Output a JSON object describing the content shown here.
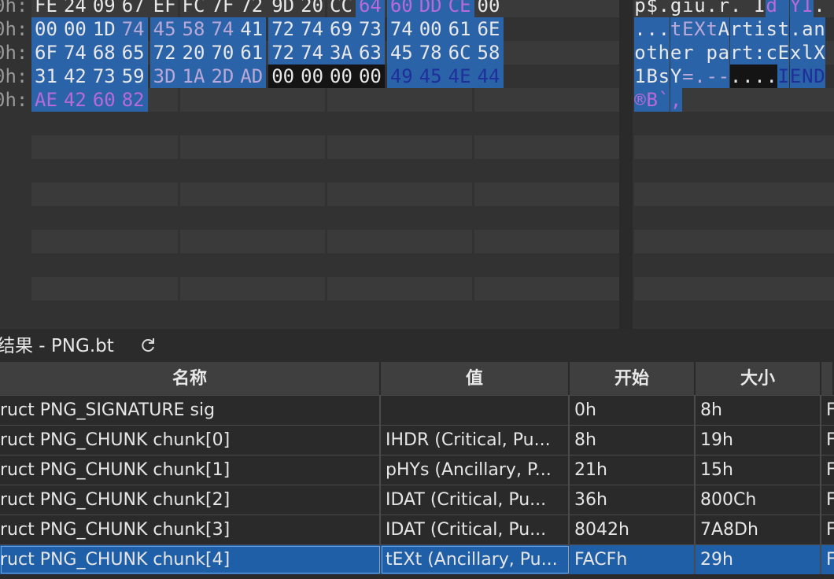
{
  "colors": {
    "pane_bg": "#323232",
    "row_band": "#3a3a3a",
    "sel_blue": "#2b63a8",
    "sel_dark": "#141414",
    "text_white": "#e8e8e8",
    "text_purple": "#b86bd8",
    "text_lightpurple": "#b9a9d8",
    "text_navy": "#1f2f9a",
    "table_selected": "#1f5fa8"
  },
  "hex": {
    "offsets": [
      "0h:",
      "0h:",
      "0h:",
      "0h:",
      "0h:"
    ],
    "rows": [
      {
        "bytes": [
          "FE",
          "24",
          "09",
          "67",
          "EF",
          "FC",
          "7F",
          "72",
          "9D",
          "20",
          "CC",
          "64",
          "60",
          "DD",
          "CE",
          "00"
        ],
        "ascii": [
          "p",
          "$",
          ".",
          "g",
          "i",
          "ü",
          ".",
          "r",
          ".",
          "",
          "Ì",
          "d",
          "`",
          "Ý",
          "Î",
          "."
        ]
      },
      {
        "bytes": [
          "00",
          "00",
          "1D",
          "74",
          "45",
          "58",
          "74",
          "41",
          "72",
          "74",
          "69",
          "73",
          "74",
          "00",
          "61",
          "6E"
        ],
        "ascii": [
          ".",
          ".",
          ".",
          "t",
          "E",
          "X",
          "t",
          "A",
          "r",
          "t",
          "i",
          "s",
          "t",
          ".",
          "a",
          "n"
        ]
      },
      {
        "bytes": [
          "6F",
          "74",
          "68",
          "65",
          "72",
          "20",
          "70",
          "61",
          "72",
          "74",
          "3A",
          "63",
          "45",
          "78",
          "6C",
          "58"
        ],
        "ascii": [
          "o",
          "t",
          "h",
          "e",
          "r",
          " ",
          "p",
          "a",
          "r",
          "t",
          ":",
          "c",
          "E",
          "x",
          "l",
          "X"
        ]
      },
      {
        "bytes": [
          "31",
          "42",
          "73",
          "59",
          "3D",
          "1A",
          "2D",
          "AD",
          "00",
          "00",
          "00",
          "00",
          "49",
          "45",
          "4E",
          "44"
        ],
        "ascii": [
          "1",
          "B",
          "s",
          "Y",
          "=",
          ".",
          "-",
          "-",
          ".",
          ".",
          ".",
          ".",
          "I",
          "E",
          "N",
          "D"
        ]
      },
      {
        "bytes": [
          "AE",
          "42",
          "60",
          "82"
        ],
        "ascii": [
          "®",
          "B",
          "`",
          "‚"
        ]
      }
    ]
  },
  "results": {
    "title": "结果 - PNG.bt",
    "refresh_icon": "refresh-icon",
    "columns": [
      "名称",
      "值",
      "开始",
      "大小",
      ""
    ],
    "rows": [
      {
        "name": "ruct PNG_SIGNATURE sig",
        "value": "",
        "start": "0h",
        "size": "8h",
        "more": "F"
      },
      {
        "name": "ruct PNG_CHUNK chunk[0]",
        "value": "IHDR  (Critical, Pu...",
        "start": "8h",
        "size": "19h",
        "more": "F"
      },
      {
        "name": "ruct PNG_CHUNK chunk[1]",
        "value": "pHYs  (Ancillary, P...",
        "start": "21h",
        "size": "15h",
        "more": "F"
      },
      {
        "name": "ruct PNG_CHUNK chunk[2]",
        "value": "IDAT  (Critical, Pu...",
        "start": "36h",
        "size": "800Ch",
        "more": "F"
      },
      {
        "name": "ruct PNG_CHUNK chunk[3]",
        "value": "IDAT  (Critical, Pu...",
        "start": "8042h",
        "size": "7A8Dh",
        "more": "F"
      },
      {
        "name": "ruct PNG_CHUNK chunk[4]",
        "value": "tEXt  (Ancillary, Pu...",
        "start": "FACFh",
        "size": "29h",
        "more": "F"
      }
    ]
  }
}
